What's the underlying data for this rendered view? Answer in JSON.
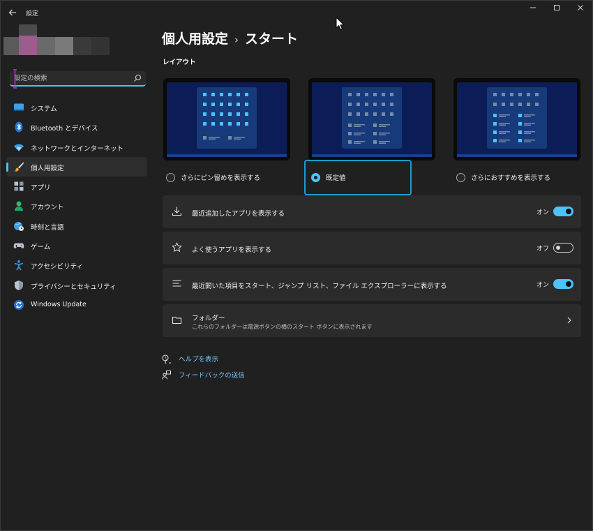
{
  "window": {
    "title": "設定"
  },
  "search": {
    "placeholder": "設定の検索"
  },
  "sidebar": {
    "items": [
      {
        "label": "システム",
        "icon": "monitor-icon"
      },
      {
        "label": "Bluetooth とデバイス",
        "icon": "bluetooth-icon"
      },
      {
        "label": "ネットワークとインターネット",
        "icon": "wifi-icon"
      },
      {
        "label": "個人用設定",
        "icon": "paintbrush-icon",
        "active": true
      },
      {
        "label": "アプリ",
        "icon": "apps-icon"
      },
      {
        "label": "アカウント",
        "icon": "person-icon"
      },
      {
        "label": "時刻と言語",
        "icon": "globe-clock-icon"
      },
      {
        "label": "ゲーム",
        "icon": "gamepad-icon"
      },
      {
        "label": "アクセシビリティ",
        "icon": "accessibility-icon"
      },
      {
        "label": "プライバシーとセキュリティ",
        "icon": "shield-icon"
      },
      {
        "label": "Windows Update",
        "icon": "update-icon"
      }
    ]
  },
  "header": {
    "parent": "個人用設定",
    "separator": "›",
    "current": "スタート"
  },
  "layout": {
    "title": "レイアウト",
    "options": [
      {
        "label": "さらにピン留めを表示する",
        "selected": false
      },
      {
        "label": "既定値",
        "selected": true
      },
      {
        "label": "さらにおすすめを表示する",
        "selected": false
      }
    ]
  },
  "settings": [
    {
      "label": "最近追加したアプリを表示する",
      "state": "オン",
      "on": true,
      "icon": "download-icon"
    },
    {
      "label": "よく使うアプリを表示する",
      "state": "オフ",
      "on": false,
      "icon": "star-icon"
    },
    {
      "label": "最近開いた項目をスタート、ジャンプ リスト、ファイル エクスプローラーに表示する",
      "state": "オン",
      "on": true,
      "icon": "list-icon"
    }
  ],
  "folders": {
    "title": "フォルダー",
    "description": "これらのフォルダーは電源ボタンの横のスタート ボタンに表示されます"
  },
  "links": {
    "help": "ヘルプを表示",
    "feedback": "フィードバックの送信"
  },
  "colors": {
    "accent": "#4cc2ff",
    "background": "#202020",
    "card": "#2b2b2b",
    "link": "#78c7ff"
  }
}
